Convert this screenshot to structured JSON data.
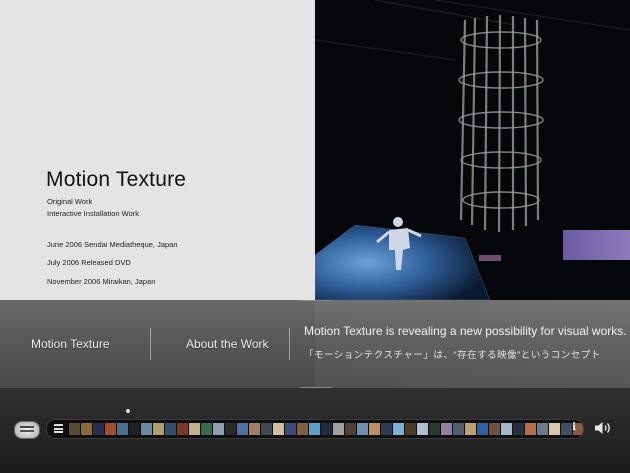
{
  "work": {
    "title": "Motion Texture",
    "subtitle_1": "Original Work",
    "subtitle_2": "Interactive Installation Work",
    "events": [
      "June 2006 Sendai Mediatheque, Japan",
      "July 2006 Released DVD",
      "November 2006 Miraikan, Japan"
    ]
  },
  "band": {
    "tab_1": "Motion Texture",
    "tab_2": "About the Work",
    "description_en": "Motion Texture is revealing a new possibility for visual works. I",
    "description_ja": "「モーションテクスチャー」は、“存在する映像”というコンセプト"
  },
  "bottom_bar": {
    "logo_icon": "tvml-logo-icon",
    "list_icon": "list-icon",
    "info_label": "i",
    "speaker_icon": "speaker-icon",
    "thumb_colors": [
      "#5a4a3a",
      "#8a6a3a",
      "#2c2c50",
      "#a05030",
      "#4a7090",
      "#202020",
      "#6a8aa0",
      "#b0a070",
      "#30506a",
      "#7a3a2a",
      "#c0b090",
      "#3a6a4a",
      "#90a0b0",
      "#2a2a2a",
      "#5070a0",
      "#a08060",
      "#404858",
      "#d0c0a0",
      "#3a4a7a",
      "#806040",
      "#60a0c0",
      "#202a3a",
      "#a0a0a0",
      "#504030",
      "#7090b0",
      "#c09060",
      "#303a50",
      "#80b0d0",
      "#4a3a2a",
      "#b0c0d0",
      "#2a3a2a",
      "#9080a0",
      "#506070",
      "#c0a070",
      "#3060a0",
      "#705040",
      "#a0b8c8",
      "#283040",
      "#b07050",
      "#6a7a8a",
      "#d8c8a8",
      "#405060",
      "#8a5a3a",
      "#90a8b8",
      "#302820",
      "#c8b8a0",
      "#506a8a",
      "#7a6a5a",
      "#b04030",
      "#3a5a7a",
      "#a09070",
      "#607080",
      "#c05040",
      "#283848",
      "#90a0a0",
      "#705848",
      "#b8c8d8",
      "#404040",
      "#a87858",
      "#5a6a7a"
    ]
  }
}
